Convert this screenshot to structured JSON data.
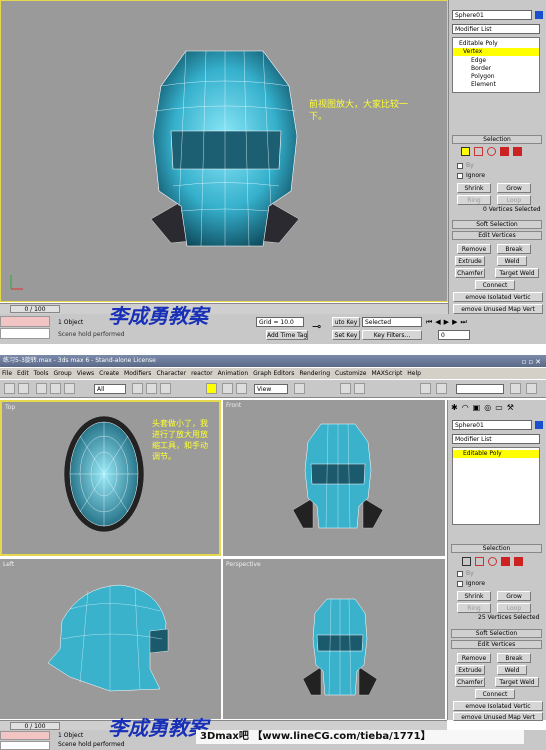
{
  "top": {
    "object_name": "Sphere01",
    "modifier_list": "Modifier List",
    "stack": [
      "Editable Poly",
      "Vertex",
      "Edge",
      "Border",
      "Polygon",
      "Element"
    ],
    "selection_title": "Selection",
    "by_label": "By",
    "ignore_label": "Ignore",
    "shrink": "Shrink",
    "grow": "Grow",
    "ring": "Ring",
    "loop": "Loop",
    "selected_info": "0 Vertices Selected",
    "soft_selection": "Soft Selection",
    "edit_vertices": "Edit Vertices",
    "remove": "Remove",
    "break": "Break",
    "extrude": "Extrude",
    "weld": "Weld",
    "chamfer": "Chamfer",
    "target_weld": "Target Weld",
    "connect": "Connect",
    "remove_isolated": "emove Isolated Vertic",
    "remove_unused": "emove Unused Map Vert",
    "note": "前视图放大，大家比较一下。",
    "time_slider": "0 / 100",
    "objects": "1 Object",
    "grid": "Grid = 10.0",
    "auto_key": "uto Key",
    "selected": "Selected",
    "set_key": "Set Key",
    "key_filters": "Key Filters...",
    "scene_hold": "Scene hold performed",
    "add_tag": "Add Time Tag",
    "frame": "0",
    "watermark": "李成勇教案"
  },
  "bottom": {
    "title": "练习5-3旋转.max - 3ds max 6 - Stand-alone License",
    "menus": [
      "File",
      "Edit",
      "Tools",
      "Group",
      "Views",
      "Create",
      "Modifiers",
      "Character",
      "reactor",
      "Animation",
      "Graph Editors",
      "Rendering",
      "Customize",
      "MAXScript",
      "Help"
    ],
    "filter": "All",
    "ref_coord": "View",
    "viewports": [
      "Top",
      "Front",
      "Left",
      "Perspective"
    ],
    "note": "头套做小了，我进行了放大用放缩工具，和手动调节。",
    "object_name": "Sphere01",
    "modifier_list": "Modifier List",
    "stack": [
      "Editable Poly"
    ],
    "selection_title": "Selection",
    "by_label": "By",
    "ignore_label": "Ignore",
    "shrink": "Shrink",
    "grow": "Grow",
    "ring": "Ring",
    "loop": "Loop",
    "selected_info": "25 Vertices Selected",
    "soft_selection": "Soft Selection",
    "edit_vertices": "Edit Vertices",
    "remove": "Remove",
    "break": "Break",
    "extrude": "Extrude",
    "weld": "Weld",
    "chamfer": "Chamfer",
    "target_weld": "Target Weld",
    "connect": "Connect",
    "remove_isolated": "emove Isolated Vertic",
    "remove_unused": "emove Unused Map Vert",
    "time_slider": "0 / 100",
    "objects": "1 Object",
    "scene_hold": "Scene hold performed",
    "watermark": "李成勇教案",
    "site": "3Dmax吧 【www.lineCG.com/tieba/1771】"
  },
  "colors": {
    "viewport": "#9a9a9a",
    "mesh": "#38b4d0",
    "note": "#ffff33",
    "watermark": "#1830b8",
    "active": "#ffff00"
  }
}
